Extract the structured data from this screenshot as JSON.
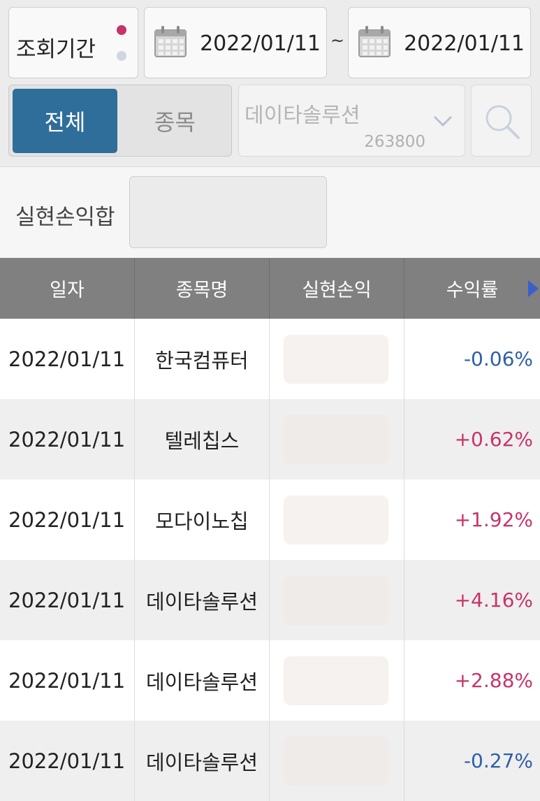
{
  "filter": {
    "period_label": "조회기간",
    "start_date": "2022/01/11",
    "separator": "~",
    "end_date": "2022/01/11",
    "scope_all": "전체",
    "scope_stock": "종목",
    "stock_name": "데이타솔루션",
    "stock_code": "263800"
  },
  "summary": {
    "label": "실현손익합"
  },
  "table": {
    "headers": [
      "일자",
      "종목명",
      "실현손익",
      "수익률"
    ],
    "rows": [
      {
        "date": "2022/01/11",
        "name": "한국컴퓨터",
        "rate": "-0.06%"
      },
      {
        "date": "2022/01/11",
        "name": "텔레칩스",
        "rate": "+0.62%"
      },
      {
        "date": "2022/01/11",
        "name": "모다이노칩",
        "rate": "+1.92%"
      },
      {
        "date": "2022/01/11",
        "name": "데이타솔루션",
        "rate": "+4.16%"
      },
      {
        "date": "2022/01/11",
        "name": "데이타솔루션",
        "rate": "+2.88%"
      },
      {
        "date": "2022/01/11",
        "name": "데이타솔루션",
        "rate": "-0.27%"
      }
    ]
  },
  "colors": {
    "accent_blue": "#2f6e9a",
    "positive": "#c8336a",
    "negative": "#2f5fa6"
  },
  "icons": [
    "calendar-icon",
    "chevron-down-icon",
    "search-icon",
    "next-column-icon"
  ]
}
